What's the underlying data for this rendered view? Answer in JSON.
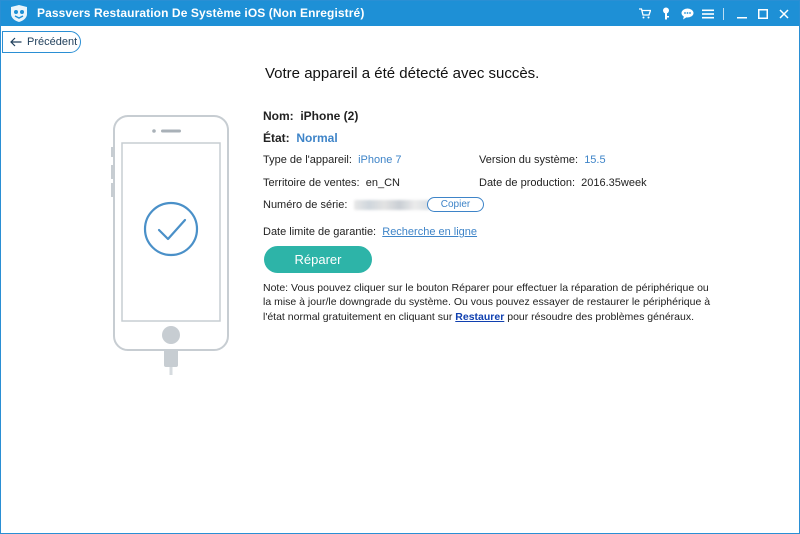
{
  "titlebar": {
    "title": "Passvers Restauration De Système iOS (Non Enregistré)",
    "icons": [
      "cart-icon",
      "key-icon",
      "chat-icon",
      "menu-icon",
      "minimize-icon",
      "maximize-icon",
      "close-icon"
    ]
  },
  "nav": {
    "back_label": "Précédent"
  },
  "main": {
    "headline": "Votre appareil a été détecté avec succès.",
    "name_label": "Nom:",
    "name_value": "iPhone (2)",
    "state_label": "État:",
    "state_value": "Normal",
    "device_type_label": "Type de l'appareil:",
    "device_type_value": "iPhone 7",
    "system_version_label": "Version du système:",
    "system_version_value": "15.5",
    "territory_label": "Territoire de ventes:",
    "territory_value": "en_CN",
    "production_date_label": "Date de production:",
    "production_date_value": "2016.35week",
    "serial_label": "Numéro de série:",
    "copy_label": "Copier",
    "warranty_label": "Date limite de garantie:",
    "warranty_link": "Recherche en ligne",
    "repair_label": "Réparer",
    "note_prefix": "Note: Vous pouvez cliquer sur le bouton Réparer pour effectuer la réparation de périphérique ou la mise à jour/le downgrade du système. Ou vous pouvez essayer de restaurer le périphérique à l'état normal gratuitement en cliquant sur ",
    "note_link": "Restaurer",
    "note_suffix": " pour résoudre des problèmes généraux."
  },
  "colors": {
    "titlebar": "#1e90d6",
    "accent_blue": "#3e84c8",
    "repair_button": "#2db4a8",
    "phone_outline": "#c7cdd2"
  }
}
